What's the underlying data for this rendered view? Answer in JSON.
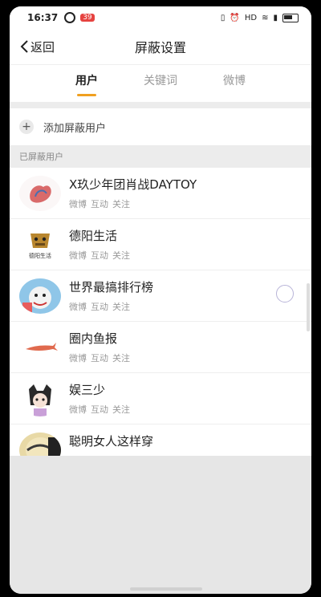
{
  "status": {
    "time": "16:37",
    "badge": "39",
    "network": "HD"
  },
  "nav": {
    "back_label": "返回",
    "title": "屏蔽设置"
  },
  "tabs": [
    {
      "label": "用户",
      "active": true
    },
    {
      "label": "关键词",
      "active": false
    },
    {
      "label": "微博",
      "active": false
    }
  ],
  "add": {
    "icon": "plus-icon",
    "label": "添加屏蔽用户"
  },
  "section": {
    "title": "已屏蔽用户"
  },
  "actions": {
    "weibo": "微博",
    "interact": "互动",
    "follow": "关注"
  },
  "users": [
    {
      "name": "X玖少年团肖战DAYTOY"
    },
    {
      "name": "德阳生活",
      "avatar_text": "德阳生活"
    },
    {
      "name": "世界最搞排行榜"
    },
    {
      "name": "圈内鱼报"
    },
    {
      "name": "娱三少"
    },
    {
      "name": "聪明女人这样穿"
    }
  ],
  "colors": {
    "accent": "#f0a020",
    "background": "#ececec"
  }
}
